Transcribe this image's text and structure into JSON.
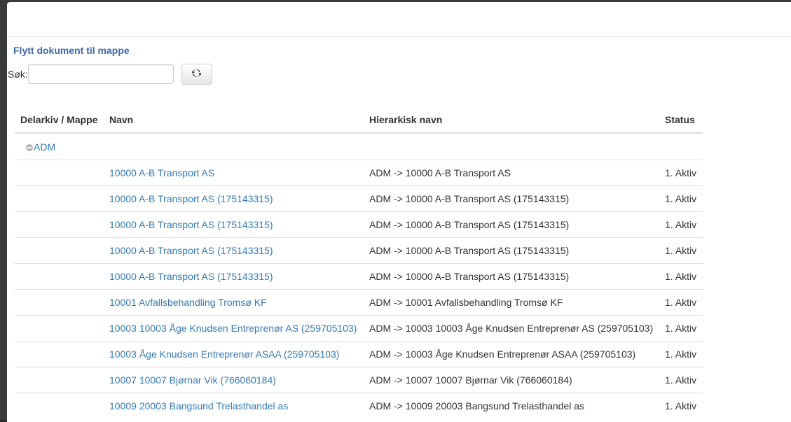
{
  "dialog": {
    "title": "Flytt dokument til mappe"
  },
  "search": {
    "label": "Søk:",
    "value": "",
    "placeholder": ""
  },
  "refresh_button": {
    "icon": "refresh-icon"
  },
  "table": {
    "headers": [
      "Delarkiv / Mappe",
      "Navn",
      "Hierarkisk navn",
      "Status"
    ],
    "group": {
      "label": "ADM",
      "icon": "collapse-minus-icon"
    },
    "rows": [
      {
        "navn": "10000 A-B Transport AS",
        "hierarkisk": "ADM -> 10000 A-B Transport AS",
        "status": "1. Aktiv"
      },
      {
        "navn": "10000 A-B Transport AS (175143315)",
        "hierarkisk": "ADM -> 10000 A-B Transport AS (175143315)",
        "status": "1. Aktiv"
      },
      {
        "navn": "10000 A-B Transport AS (175143315)",
        "hierarkisk": "ADM -> 10000 A-B Transport AS (175143315)",
        "status": "1. Aktiv"
      },
      {
        "navn": "10000 A-B Transport AS (175143315)",
        "hierarkisk": "ADM -> 10000 A-B Transport AS (175143315)",
        "status": "1. Aktiv"
      },
      {
        "navn": "10000 A-B Transport AS (175143315)",
        "hierarkisk": "ADM -> 10000 A-B Transport AS (175143315)",
        "status": "1. Aktiv"
      },
      {
        "navn": "10001 Avfallsbehandling Tromsø KF",
        "hierarkisk": "ADM -> 10001 Avfallsbehandling Tromsø KF",
        "status": "1. Aktiv"
      },
      {
        "navn": "10003 10003 Åge Knudsen Entreprenør AS (259705103)",
        "hierarkisk": "ADM -> 10003 10003 Åge Knudsen Entreprenør AS (259705103)",
        "status": "1. Aktiv"
      },
      {
        "navn": "10003 Åge Knudsen Entreprenør ASAA (259705103)",
        "hierarkisk": "ADM -> 10003 Åge Knudsen Entreprenør ASAA (259705103)",
        "status": "1. Aktiv"
      },
      {
        "navn": "10007 10007 Bjørnar Vik (766060184)",
        "hierarkisk": "ADM -> 10007 10007 Bjørnar Vik (766060184)",
        "status": "1. Aktiv"
      },
      {
        "navn": "10009 20003 Bangsund Trelasthandel as",
        "hierarkisk": "ADM -> 10009 20003 Bangsund Trelasthandel as",
        "status": "1. Aktiv"
      }
    ]
  },
  "colors": {
    "title": "#3e6aa9",
    "link": "#337ab7",
    "border": "#dddddd"
  }
}
